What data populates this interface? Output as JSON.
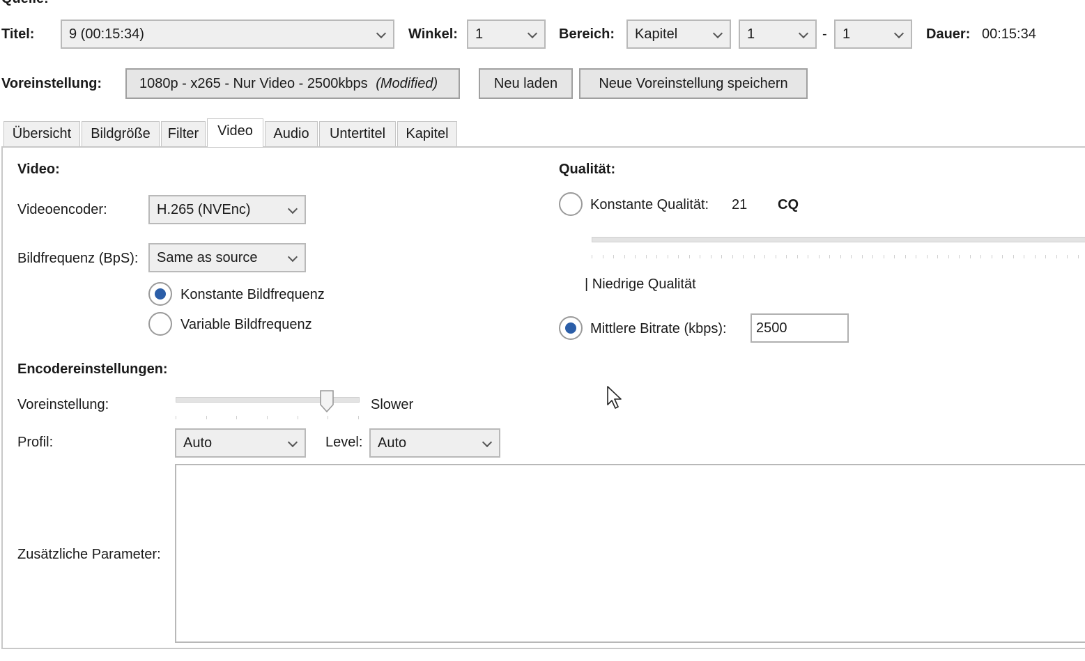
{
  "header": {
    "source_label": "Quelle:",
    "title_label": "Titel:",
    "title_value": "9  (00:15:34)",
    "angle_label": "Winkel:",
    "angle_value": "1",
    "range_label": "Bereich:",
    "range_type": "Kapitel",
    "range_start": "1",
    "range_sep": "-",
    "range_end": "1",
    "duration_label": "Dauer:",
    "duration_value": "00:15:34"
  },
  "preset": {
    "label": "Voreinstellung:",
    "value": "1080p - x265 - Nur Video - 2500kbps",
    "modified": "(Modified)",
    "reload_label": "Neu laden",
    "save_new_label": "Neue Voreinstellung speichern"
  },
  "tabs": [
    {
      "label": "Übersicht"
    },
    {
      "label": "Bildgröße"
    },
    {
      "label": "Filter"
    },
    {
      "label": "Video"
    },
    {
      "label": "Audio"
    },
    {
      "label": "Untertitel"
    },
    {
      "label": "Kapitel"
    }
  ],
  "video": {
    "section_title": "Video:",
    "encoder_label": "Videoencoder:",
    "encoder_value": "H.265 (NVEnc)",
    "framerate_label": "Bildfrequenz (BpS):",
    "framerate_value": "Same as source",
    "constant_fr_label": "Konstante Bildfrequenz",
    "variable_fr_label": "Variable Bildfrequenz",
    "framerate_mode": "constant"
  },
  "quality": {
    "section_title": "Qualität:",
    "cq_label": "Konstante Qualität:",
    "cq_value": "21",
    "cq_unit": "CQ",
    "low_quality_label": "| Niedrige Qualität",
    "avg_bitrate_label": "Mittlere Bitrate (kbps):",
    "avg_bitrate_value": "2500",
    "mode": "avg_bitrate"
  },
  "encoder": {
    "section_title": "Encodereinstellungen:",
    "preset_label": "Voreinstellung:",
    "preset_value": "Slower",
    "preset_slider_fraction": 0.83,
    "profile_label": "Profil:",
    "profile_value": "Auto",
    "level_label": "Level:",
    "level_value": "Auto",
    "extra_params_label": "Zusätzliche Parameter:",
    "extra_params_value": ""
  }
}
